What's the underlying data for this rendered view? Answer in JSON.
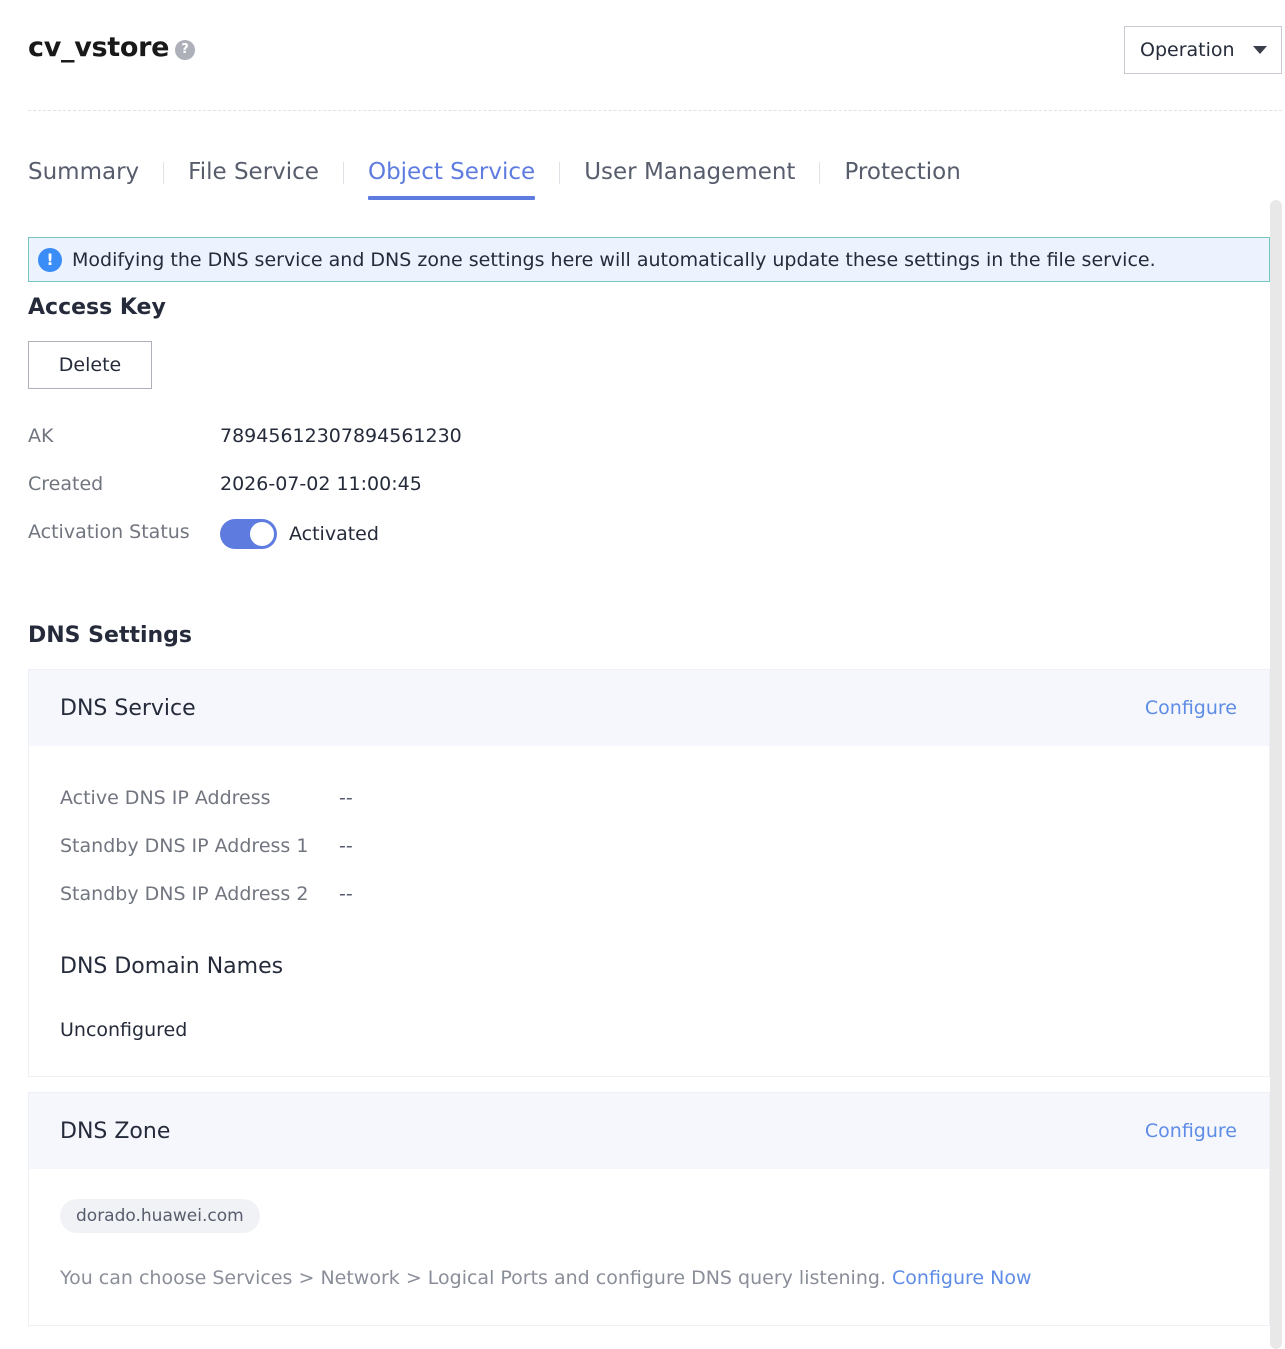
{
  "header": {
    "title": "cv_vstore",
    "help_icon": "?",
    "operation_label": "Operation"
  },
  "tabs": [
    {
      "label": "Summary",
      "active": false
    },
    {
      "label": "File Service",
      "active": false
    },
    {
      "label": "Object Service",
      "active": true
    },
    {
      "label": "User Management",
      "active": false
    },
    {
      "label": "Protection",
      "active": false
    }
  ],
  "notice": {
    "icon": "!",
    "text": "Modifying the DNS service and DNS zone settings here will automatically update these settings in the file service."
  },
  "access_key": {
    "title": "Access Key",
    "delete_label": "Delete",
    "ak_label": "AK",
    "ak_value": "78945612307894561230",
    "created_label": "Created",
    "created_value": "2026-07-02 11:00:45",
    "status_label": "Activation Status",
    "status_value": "Activated",
    "status_on": true
  },
  "dns_settings": {
    "title": "DNS Settings",
    "service": {
      "title": "DNS Service",
      "configure_label": "Configure",
      "rows": [
        {
          "label": "Active DNS IP Address",
          "value": "--"
        },
        {
          "label": "Standby DNS IP Address 1",
          "value": "--"
        },
        {
          "label": "Standby DNS IP Address 2",
          "value": "--"
        }
      ],
      "domain_names_title": "DNS Domain Names",
      "domain_names_value": "Unconfigured"
    },
    "zone": {
      "title": "DNS Zone",
      "configure_label": "Configure",
      "tag": "dorado.huawei.com",
      "hint": "You can choose Services > Network > Logical Ports and configure DNS query listening.",
      "hint_link": "Configure Now"
    }
  },
  "colors": {
    "accent": "#5e7ce0",
    "link": "#5e8ce6",
    "notice_bg": "#edf2ff",
    "notice_border": "#73c7c0",
    "info_icon": "#3a8cf7"
  }
}
